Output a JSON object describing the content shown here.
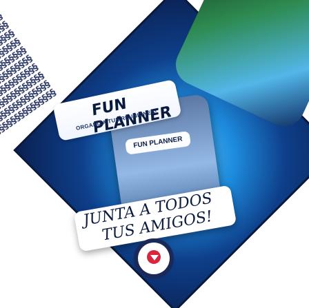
{
  "promo": {
    "banner_title": "FUN PLANNER",
    "banner_subtitle": "ORGANIZA TUS REUNIONES!",
    "phone_button": "FUN PLANNER",
    "cta_line1": "JUNTA A TODOS",
    "cta_line2": "TUS AMIGOS!"
  },
  "icons": {
    "play": "circle-play-down-icon"
  },
  "colors": {
    "diamond": "#1e8cdd",
    "navy": "#0a1a3f",
    "accent_red": "#d7263d"
  }
}
